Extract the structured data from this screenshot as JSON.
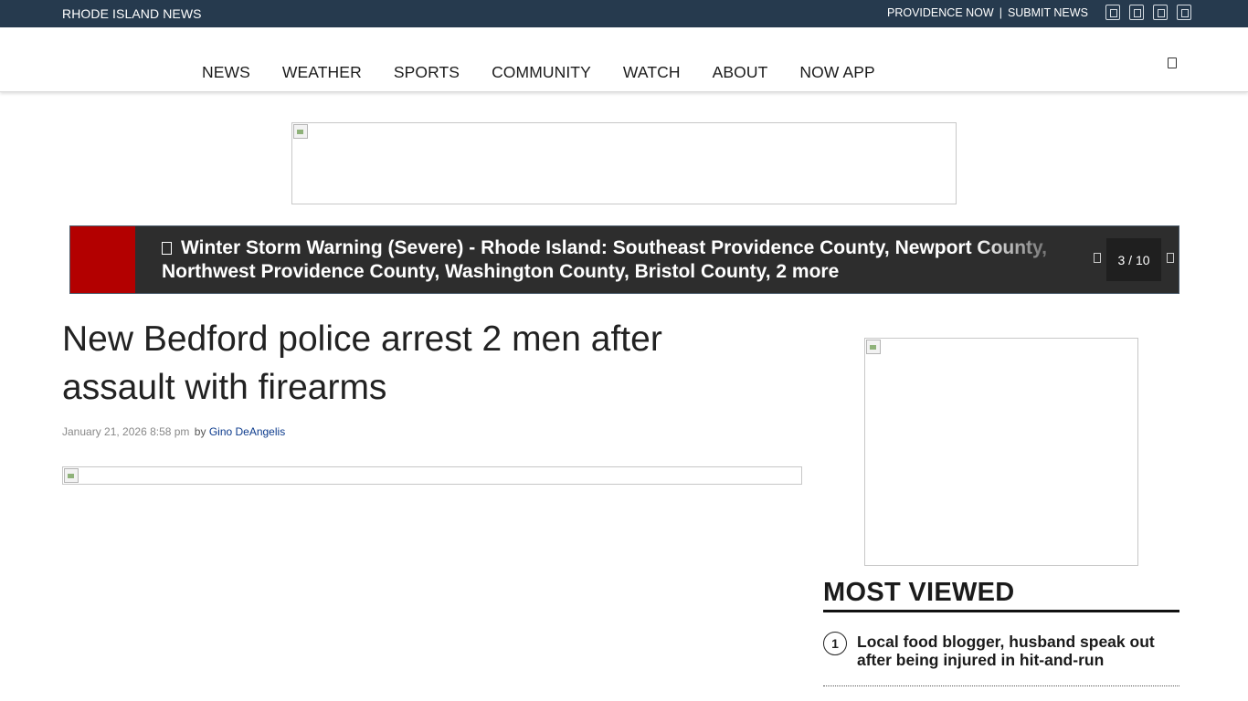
{
  "topbar": {
    "site_name": "RHODE ISLAND NEWS",
    "links": [
      "PROVIDENCE NOW",
      "SUBMIT NEWS"
    ],
    "social_icons": [
      "social-icon-1",
      "social-icon-2",
      "social-icon-3",
      "social-icon-4"
    ]
  },
  "nav": {
    "items": [
      "NEWS",
      "WEATHER",
      "SPORTS",
      "COMMUNITY",
      "WATCH",
      "ABOUT",
      "NOW APP"
    ],
    "search_icon": "search-icon"
  },
  "alert": {
    "line1": "Winter Storm Warning (Severe) - Rhode Island: Southeast Providence County, Newport County,",
    "line2": "Northwest Providence County, Washington County, Bristol County, 2 more",
    "counter": "3 / 10",
    "accent_color": "#b30000"
  },
  "article": {
    "headline": "New Bedford police arrest 2 men after assault with firearms",
    "date": "January 21, 2026 8:58 pm",
    "by": "by",
    "author": "Gino DeAngelis"
  },
  "sidebar": {
    "most_viewed_title": "MOST VIEWED",
    "items": [
      {
        "number": "1",
        "title": "Local food blogger, husband speak out after being injured in hit-and-run"
      }
    ]
  }
}
